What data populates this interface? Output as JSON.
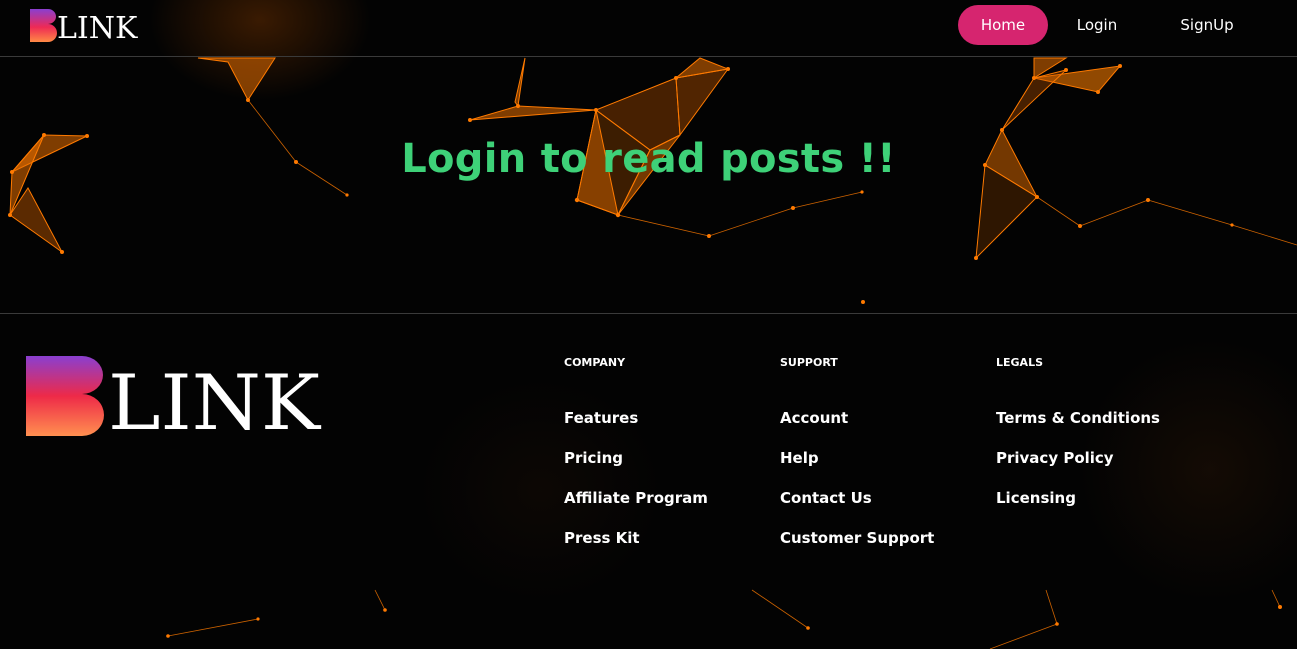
{
  "header": {
    "logo_text": "LINK",
    "nav": {
      "home": "Home",
      "login": "Login",
      "signup": "SignUp"
    }
  },
  "hero": {
    "title": "Login to read posts !!"
  },
  "footer": {
    "logo_text": "LINK",
    "columns": [
      {
        "title": "COMPANY",
        "links": [
          "Features",
          "Pricing",
          "Affiliate Program",
          "Press Kit"
        ]
      },
      {
        "title": "SUPPORT",
        "links": [
          "Account",
          "Help",
          "Contact Us",
          "Customer Support"
        ]
      },
      {
        "title": "LEGALS",
        "links": [
          "Terms & Conditions",
          "Privacy Policy",
          "Licensing"
        ]
      }
    ]
  },
  "colors": {
    "accent": "#d6256f",
    "hero_text": "#3ed178",
    "network": "#ff7a00",
    "background": "#030303"
  }
}
